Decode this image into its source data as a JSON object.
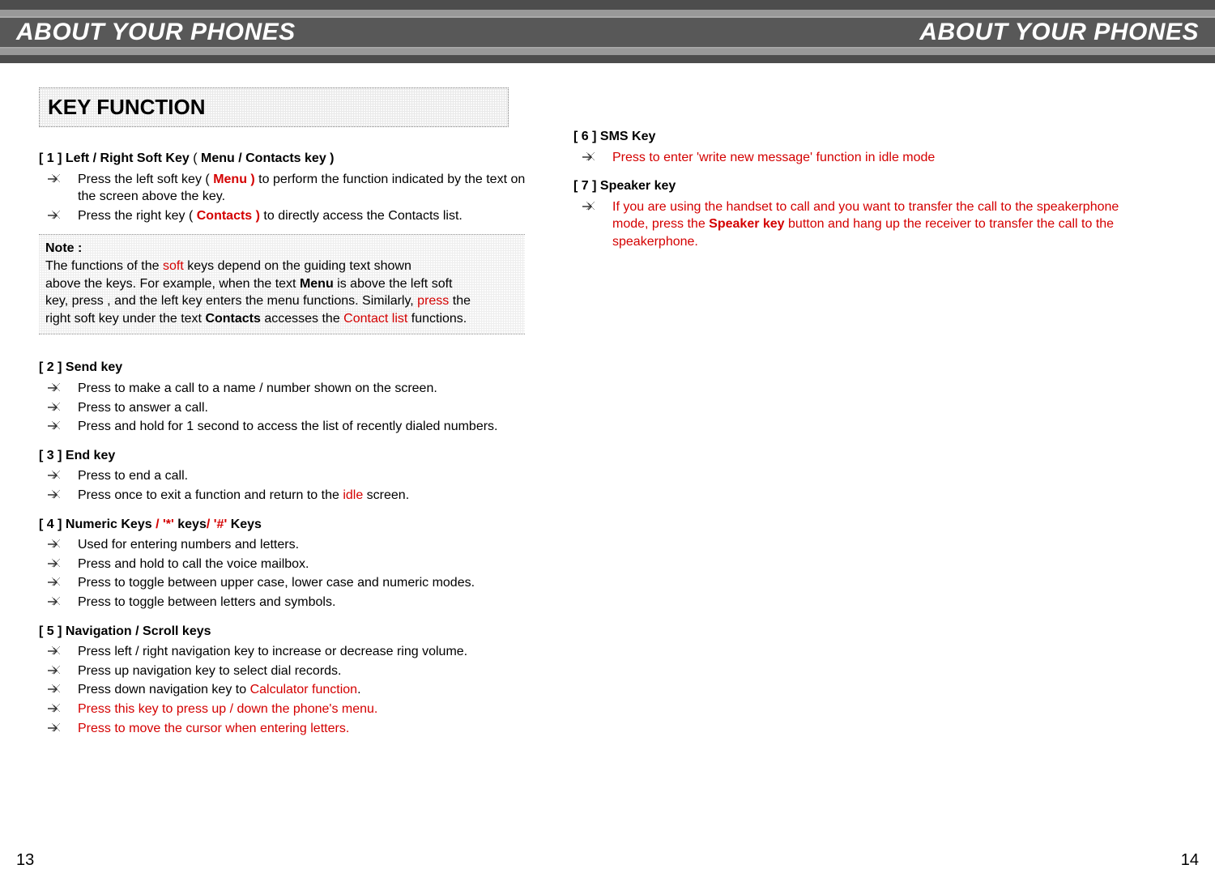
{
  "header": {
    "left_title": "ABOUT YOUR PHONES",
    "right_title": "ABOUT YOUR PHONES"
  },
  "section_title": "KEY FUNCTION",
  "left_column": {
    "item1": {
      "heading_num": "[ 1 ] ",
      "heading_main": "Left / Right Soft Key",
      "heading_paren_open": "( ",
      "heading_paren_label": "Menu / Contacts key )",
      "bullets": {
        "b1_pre": "Press the left soft key ",
        "b1_paren": "( ",
        "b1_red": "Menu )",
        "b1_post": " to perform the function indicated by the text on the screen above the key.",
        "b2_pre": "Press the right key ",
        "b2_paren": "( ",
        "b2_red": "Contacts )",
        "b2_post": " to directly access the Contacts list."
      }
    },
    "note": {
      "title": "Note :",
      "l1_pre": "The functions of the ",
      "l1_red": "soft",
      "l1_post": " keys depend on the guiding text shown",
      "l2_pre": "above the keys. For example, when the text  ",
      "l2_bold": "Menu",
      "l2_post": " is above the left soft",
      "l3_pre": "key, press , and the left key enters the menu functions. Similarly, ",
      "l3_red": "press",
      "l3_post": " the",
      "l4_pre": "right soft  key under the text ",
      "l4_bold": "Contacts",
      "l4_mid": " accesses the ",
      "l4_red": "Contact list",
      "l4_post": " functions."
    },
    "item2": {
      "heading": "[ 2 ]  Send key",
      "b1": "Press to make a call to a name / number shown on the screen.",
      "b2": "Press to answer a call.",
      "b3": "Press and hold for 1 second to access the list of recently dialed numbers."
    },
    "item3": {
      "heading": "[ 3 ]  End key",
      "b1": "Press to end a call.",
      "b2_pre": "Press once to exit a function and return to the ",
      "b2_red": "idle",
      "b2_post": " screen."
    },
    "item4": {
      "heading_pre": "[ 4 ]  Numeric Keys ",
      "heading_red1": "/ '*'",
      "heading_mid": " keys",
      "heading_red2": "/ '#'",
      "heading_post": " Keys",
      "b1": "Used for entering numbers and letters.",
      "b2": "Press and hold to call the voice mailbox.",
      "b3": "Press to toggle between upper case, lower case and numeric modes.",
      "b4": "Press to toggle between letters and symbols."
    },
    "item5": {
      "heading": "[ 5 ]  Navigation / Scroll keys",
      "b1": "Press left / right navigation key to increase or decrease ring volume.",
      "b2": "Press up navigation key to select dial records.",
      "b3_pre": "Press down navigation key to ",
      "b3_red": "Calculator function",
      "b3_post": ".",
      "b4": "Press this key to press up / down the phone's menu.",
      "b5": "Press to move the cursor when entering letters."
    }
  },
  "right_column": {
    "item6": {
      "heading": "[ 6 ]  SMS Key",
      "b1": "Press to enter 'write new message' function in idle mode"
    },
    "item7": {
      "heading": "[ 7 ]  Speaker key",
      "b1_pre": "If you are using the handset to call and you want to transfer the call to the speakerphone mode, press the ",
      "b1_bold": "Speaker key",
      "b1_post": " button and hang up the receiver to transfer the call to the speakerphone."
    }
  },
  "page_numbers": {
    "left": "13",
    "right": "14"
  }
}
